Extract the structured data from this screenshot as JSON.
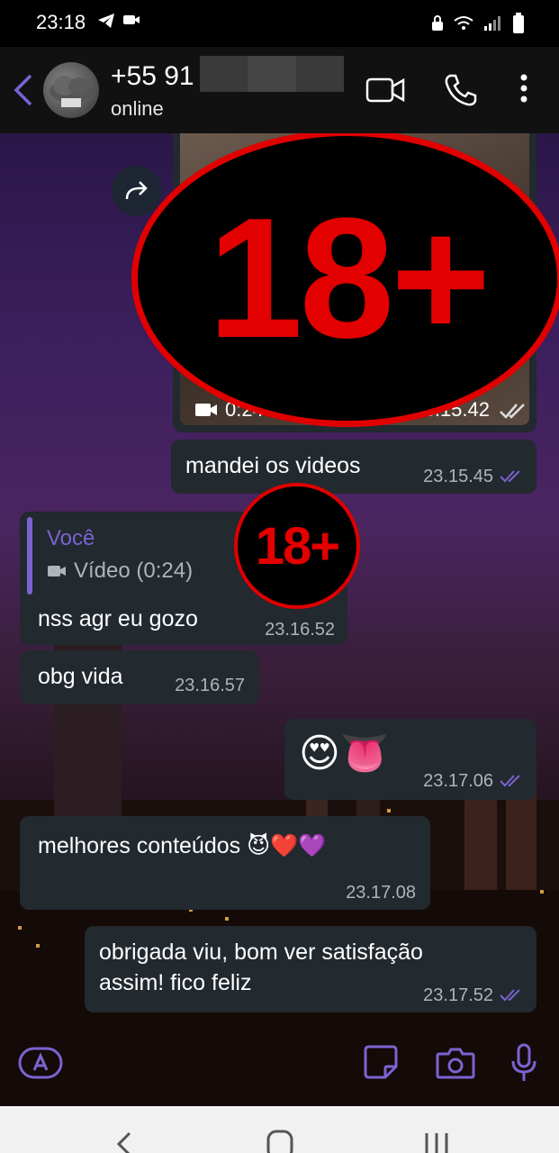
{
  "status_bar": {
    "time": "23:18",
    "icons": [
      "telegram-icon",
      "video-notification-icon",
      "lock-icon",
      "wifi-icon",
      "signal-icon",
      "battery-icon"
    ]
  },
  "header": {
    "contact_name": "+55 91",
    "contact_status": "online",
    "icons": [
      "back-arrow-icon",
      "video-call-icon",
      "phone-icon",
      "more-vert-icon"
    ]
  },
  "messages": [
    {
      "type": "video",
      "direction": "out",
      "duration": "0:24",
      "time": "23.15.42",
      "overlay": "18+"
    },
    {
      "type": "text",
      "direction": "out",
      "text": "mandei os videos",
      "time": "23.15.45"
    },
    {
      "type": "reply",
      "direction": "in",
      "reply_author": "Você",
      "reply_snippet": "Vídeo (0:24)",
      "text": "nss agr eu gozo",
      "time": "23.16.52",
      "overlay": "18+"
    },
    {
      "type": "text",
      "direction": "in",
      "text": "obg vida",
      "time": "23.16.57"
    },
    {
      "type": "emoji",
      "direction": "out",
      "text": "😍👅",
      "time": "23.17.06"
    },
    {
      "type": "text",
      "direction": "in",
      "text": "melhores conteúdos 😈❤️💜",
      "time": "23.17.08"
    },
    {
      "type": "text",
      "direction": "out",
      "text_line1": "obrigada viu, bom ver satisfação",
      "text_line2": "assim! fico feliz",
      "time": "23.17.52"
    }
  ],
  "overlay_labels": {
    "big": "18+",
    "small": "18+"
  },
  "input_bar": {
    "icons": [
      "app-store-icon",
      "sticker-icon",
      "camera-icon",
      "mic-icon"
    ]
  },
  "nav_bar": {
    "icons": [
      "nav-back-icon",
      "nav-home-icon",
      "nav-recents-icon"
    ]
  },
  "colors": {
    "accent": "#7b63d1",
    "bubble": "#22292f",
    "badge_red": "#e30000"
  }
}
